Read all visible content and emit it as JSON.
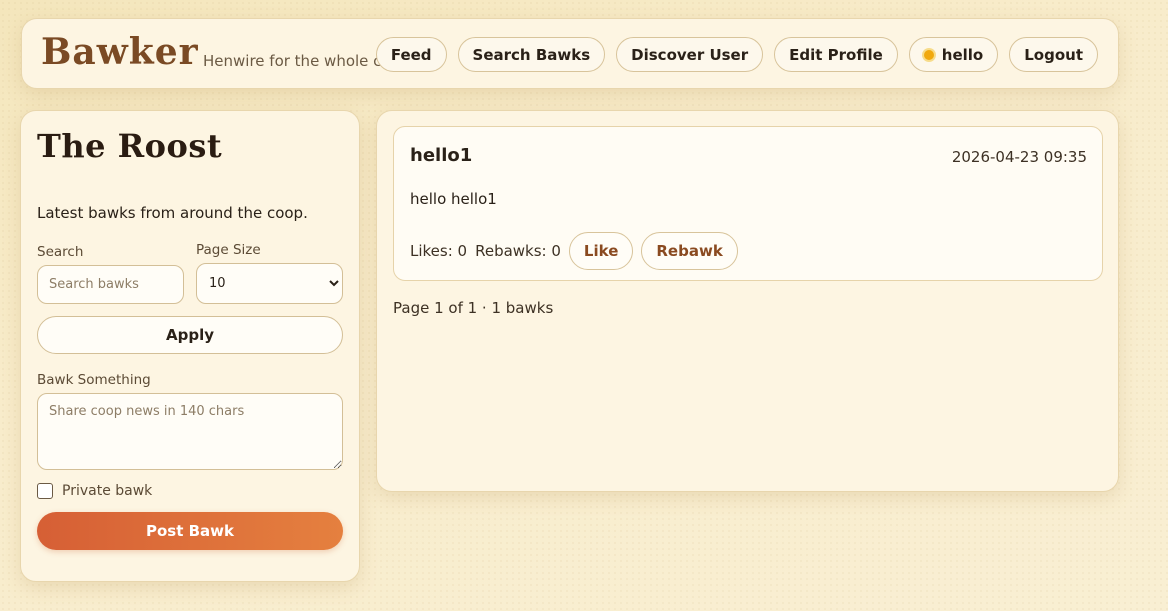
{
  "header": {
    "brand": "Bawker",
    "tagline": "Henwire for the whole coop",
    "nav": {
      "feed": "Feed",
      "search": "Search Bawks",
      "discover": "Discover User",
      "edit_profile": "Edit Profile",
      "user": "hello",
      "logout": "Logout"
    },
    "status_color": "#f1a90f"
  },
  "sidebar": {
    "title": "The Roost",
    "subtitle": "Latest bawks from around the coop.",
    "search_label": "Search",
    "search_placeholder": "Search bawks",
    "page_size_label": "Page Size",
    "page_size_value": "10",
    "apply_label": "Apply",
    "compose_label": "Bawk Something",
    "compose_placeholder": "Share coop news in 140 chars",
    "private_label": "Private bawk",
    "private_checked": false,
    "post_label": "Post Bawk"
  },
  "feed": {
    "posts": [
      {
        "author": "hello1",
        "timestamp": "2026-04-23 09:35",
        "content": "hello hello1",
        "likes_text": "Likes: 0",
        "rebawks_text": "Rebawks: 0",
        "like_label": "Like",
        "rebawk_label": "Rebawk"
      }
    ],
    "pagination": "Page 1 of 1 · 1 bawks"
  },
  "colors": {
    "accent": "#d65f35",
    "accent_end": "#e5803f",
    "brand": "#7a4a24",
    "background": "#f6ebc8"
  }
}
